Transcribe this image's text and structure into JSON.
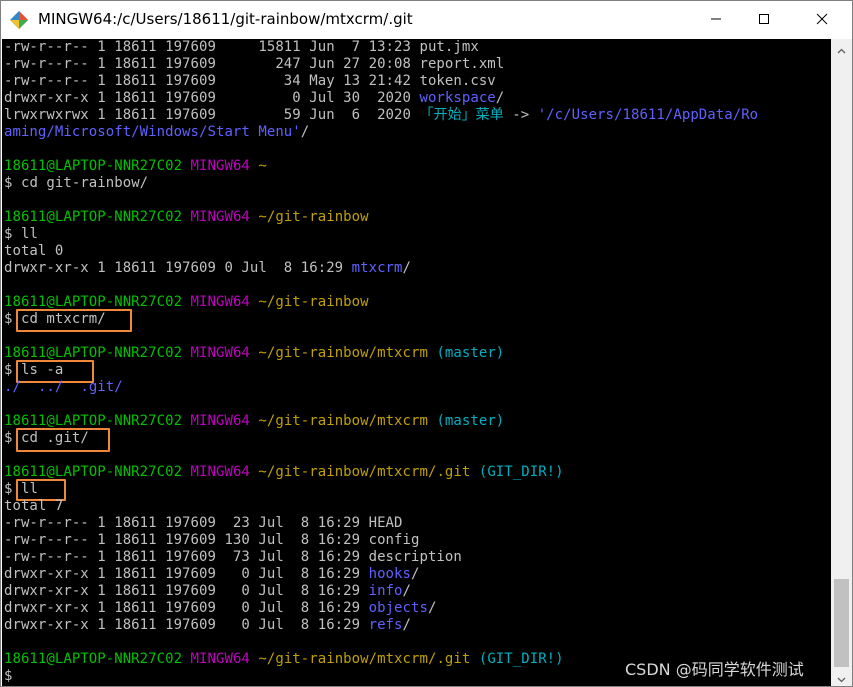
{
  "window": {
    "title": "MINGW64:/c/Users/18611/git-rainbow/mtxcrm/.git",
    "icon": "git-bash-icon",
    "controls": [
      "minimize-icon",
      "maximize-icon",
      "close-icon"
    ]
  },
  "colors": {
    "user": "#00c000",
    "env": "#c000c0",
    "path": "#c0a000",
    "branch": "#00b0c0",
    "directory": "#6060ff",
    "highlight": "#f0883a"
  },
  "ls1": [
    {
      "meta": "-rw-r--r-- 1 18611 197609     15811 Jun  7 13:23 ",
      "name": "put.jmx",
      "dir": false
    },
    {
      "meta": "-rw-r--r-- 1 18611 197609       247 Jun 27 20:08 ",
      "name": "report.xml",
      "dir": false
    },
    {
      "meta": "-rw-r--r-- 1 18611 197609        34 May 13 21:42 ",
      "name": "token.csv",
      "dir": false
    },
    {
      "meta": "drwxr-xr-x 1 18611 197609         0 Jul 30  2020 ",
      "name": "workspace",
      "dir": true
    },
    {
      "meta": "lrwxrwxrwx 1 18611 197609        59 Jun  6  2020 ",
      "name": "「开始」菜单",
      "dir": true
    }
  ],
  "link": {
    "arrow": " -> ",
    "target_part1": "'/c/Users/18611/AppData/Ro",
    "target_part2": "aming/Microsoft/Windows/Start Menu'",
    "suffix": "/"
  },
  "prompt": {
    "user": "18611@LAPTOP-NNR27C02",
    "env": "MINGW64",
    "symbol": "$"
  },
  "blocks": [
    {
      "path": "~",
      "branch": "",
      "cmd": "cd git-rainbow/"
    },
    {
      "path": "~/git-rainbow",
      "branch": "",
      "cmd": "ll"
    },
    {
      "path": "~/git-rainbow",
      "branch": "",
      "cmd": "cd mtxcrm/"
    },
    {
      "path": "~/git-rainbow/mtxcrm",
      "branch": "(master)",
      "cmd": "ls -a"
    },
    {
      "path": "~/git-rainbow/mtxcrm",
      "branch": "(master)",
      "cmd": "cd .git/"
    },
    {
      "path": "~/git-rainbow/mtxcrm/.git",
      "branch": "(GIT_DIR!)",
      "cmd": "ll"
    },
    {
      "path": "~/git-rainbow/mtxcrm/.git",
      "branch": "(GIT_DIR!)",
      "cmd": ""
    }
  ],
  "ll_rainbow": {
    "total": "total 0",
    "meta": "drwxr-xr-x 1 18611 197609 0 Jul  8 16:29 ",
    "name": "mtxcrm",
    "suffix": "/"
  },
  "ls_a": {
    "entries": [
      "./",
      "../",
      ".git/"
    ]
  },
  "ll_git": {
    "total": "total 7",
    "entries": [
      {
        "meta": "-rw-r--r-- 1 18611 197609  23 Jul  8 16:29 ",
        "name": "HEAD",
        "dir": false
      },
      {
        "meta": "-rw-r--r-- 1 18611 197609 130 Jul  8 16:29 ",
        "name": "config",
        "dir": false
      },
      {
        "meta": "-rw-r--r-- 1 18611 197609  73 Jul  8 16:29 ",
        "name": "description",
        "dir": false
      },
      {
        "meta": "drwxr-xr-x 1 18611 197609   0 Jul  8 16:29 ",
        "name": "hooks",
        "dir": true
      },
      {
        "meta": "drwxr-xr-x 1 18611 197609   0 Jul  8 16:29 ",
        "name": "info",
        "dir": true
      },
      {
        "meta": "drwxr-xr-x 1 18611 197609   0 Jul  8 16:29 ",
        "name": "objects",
        "dir": true
      },
      {
        "meta": "drwxr-xr-x 1 18611 197609   0 Jul  8 16:29 ",
        "name": "refs",
        "dir": true
      }
    ]
  },
  "watermark": "CSDN @码同学软件测试"
}
